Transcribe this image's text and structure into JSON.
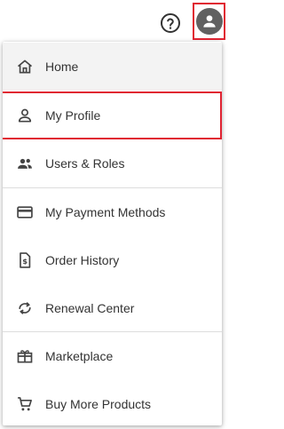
{
  "header": {
    "help_icon": "help-circle-icon",
    "avatar_icon": "account-circle-icon"
  },
  "menu": {
    "items": [
      {
        "label": "Home",
        "icon": "home-icon"
      },
      {
        "label": "My Profile",
        "icon": "person-icon"
      },
      {
        "label": "Users & Roles",
        "icon": "group-icon"
      },
      {
        "label": "My Payment Methods",
        "icon": "credit-card-icon"
      },
      {
        "label": "Order History",
        "icon": "invoice-icon"
      },
      {
        "label": "Renewal Center",
        "icon": "refresh-icon"
      },
      {
        "label": "Marketplace",
        "icon": "gift-icon"
      },
      {
        "label": "Buy More Products",
        "icon": "cart-icon"
      }
    ]
  },
  "colors": {
    "highlight_border": "#e02331",
    "avatar_bg": "#616161",
    "hover_bg": "#f3f3f3"
  }
}
